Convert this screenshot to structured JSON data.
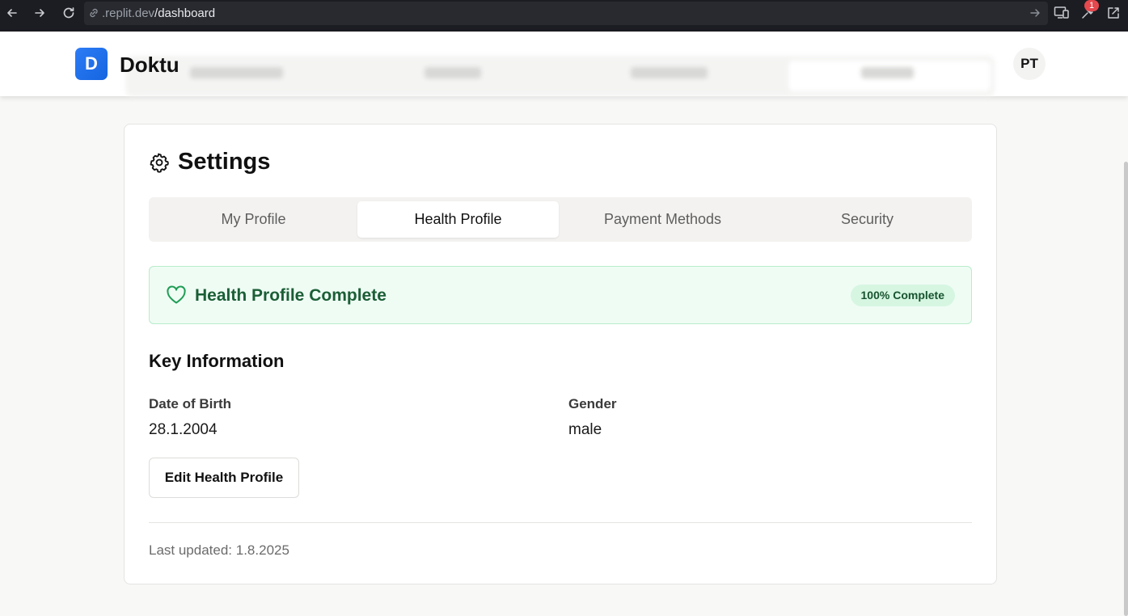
{
  "browser": {
    "url_prefix": ".replit.dev",
    "url_path": "/dashboard",
    "extension_badge": "1"
  },
  "header": {
    "logo_letter": "D",
    "brand": "Doktu",
    "avatar_initials": "PT"
  },
  "settings": {
    "title": "Settings",
    "tabs": [
      {
        "label": "My Profile",
        "active": false
      },
      {
        "label": "Health Profile",
        "active": true
      },
      {
        "label": "Payment Methods",
        "active": false
      },
      {
        "label": "Security",
        "active": false
      }
    ],
    "banner": {
      "title": "Health Profile Complete",
      "completion": "100% Complete",
      "completion_value": 100
    },
    "key_info": {
      "heading": "Key Information",
      "fields": [
        {
          "label": "Date of Birth",
          "value": "28.1.2004"
        },
        {
          "label": "Gender",
          "value": "male"
        }
      ]
    },
    "edit_button": "Edit Health Profile",
    "last_updated": "Last updated: 1.8.2025"
  },
  "colors": {
    "brand_blue": "#1565e0",
    "success_green": "#1b5e36",
    "success_bg": "#effcf4",
    "browser_chrome": "#1c1d22"
  }
}
